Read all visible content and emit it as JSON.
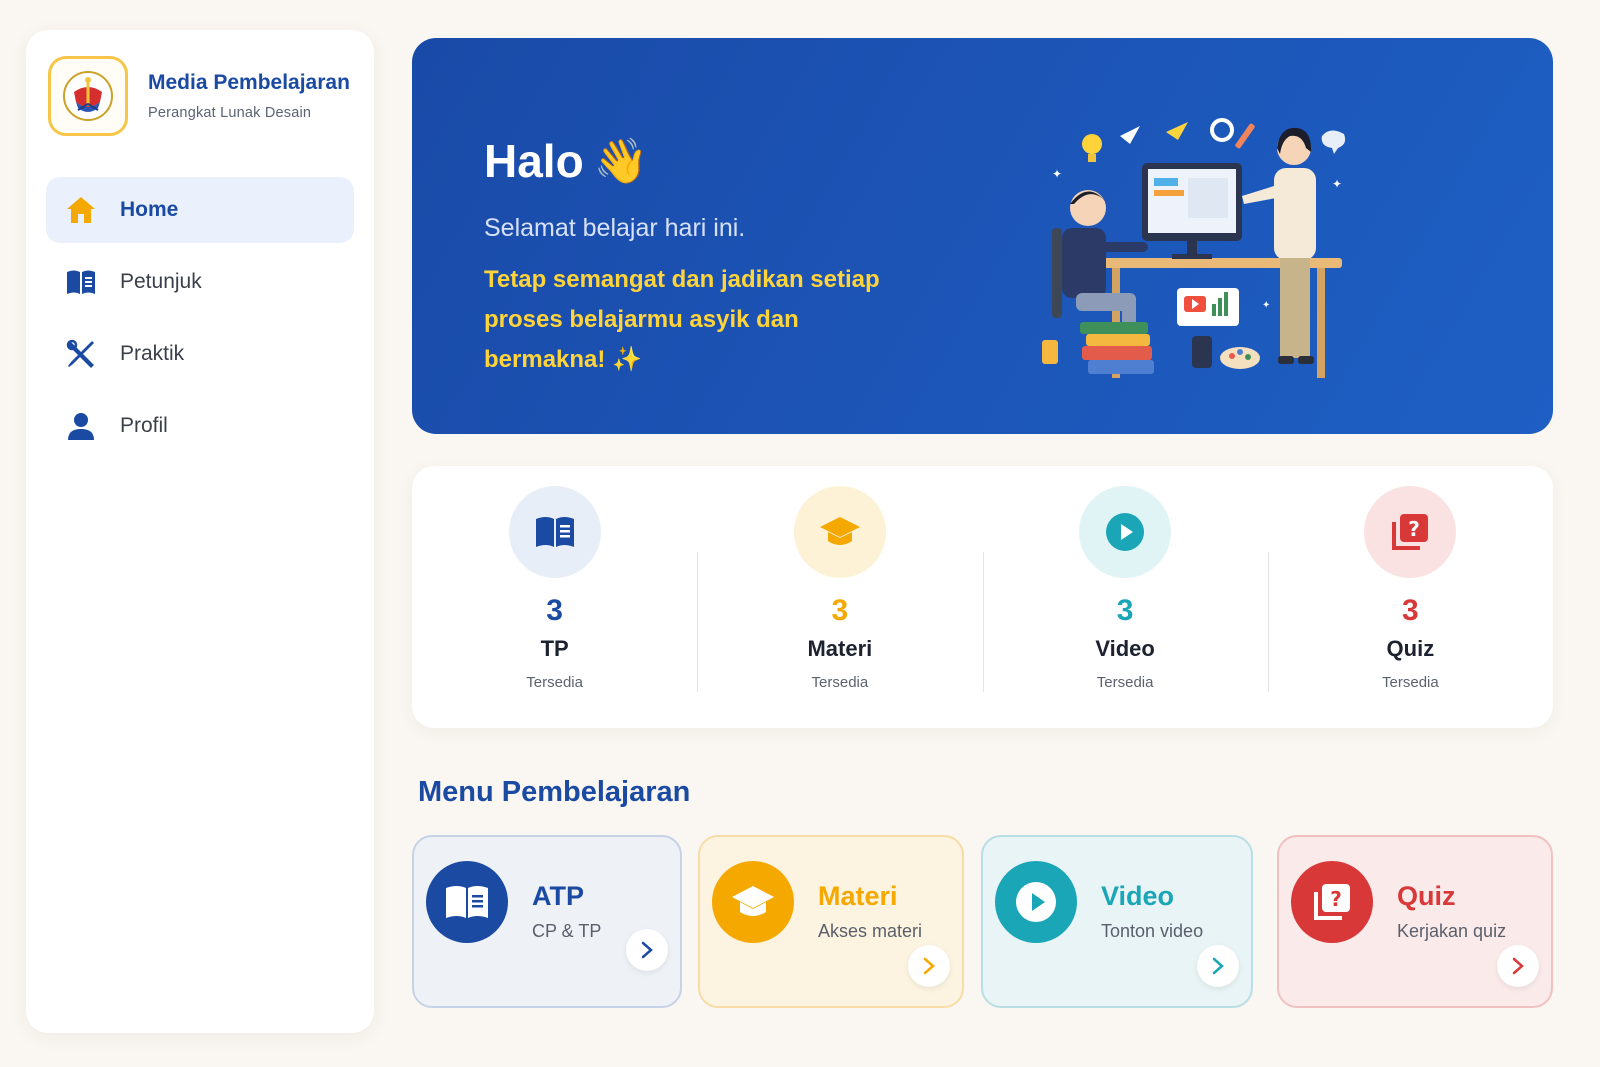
{
  "brand": {
    "title": "Media Pembelajaran",
    "subtitle": "Perangkat Lunak Desain",
    "logo": "school-emblem-icon"
  },
  "nav": {
    "items": [
      {
        "label": "Home",
        "icon": "home-icon",
        "active": true
      },
      {
        "label": "Petunjuk",
        "icon": "book-icon",
        "active": false
      },
      {
        "label": "Praktik",
        "icon": "tools-icon",
        "active": false
      },
      {
        "label": "Profil",
        "icon": "user-icon",
        "active": false
      }
    ]
  },
  "hero": {
    "greeting": "Halo",
    "greeting_emoji": "👋",
    "subtitle": "Selamat belajar hari ini.",
    "message": "Tetap semangat dan jadikan setiap proses belajarmu asyik dan bermakna! ✨",
    "illustration": "students-at-computer-illustration"
  },
  "stats": [
    {
      "count": "3",
      "name": "TP",
      "desc": "Tersedia",
      "icon": "book-icon",
      "color": "#1b4aa3",
      "bg": "#e8eef8"
    },
    {
      "count": "3",
      "name": "Materi",
      "desc": "Tersedia",
      "icon": "graduation-cap-icon",
      "color": "#f5a900",
      "bg": "#fdf1d6"
    },
    {
      "count": "3",
      "name": "Video",
      "desc": "Tersedia",
      "icon": "play-icon",
      "color": "#1aa6b7",
      "bg": "#e0f3f5"
    },
    {
      "count": "3",
      "name": "Quiz",
      "desc": "Tersedia",
      "icon": "quiz-icon",
      "color": "#d93838",
      "bg": "#fbe2e2"
    }
  ],
  "menu": {
    "title": "Menu Pembelajaran",
    "cards": [
      {
        "title": "ATP",
        "subtitle": "CP & TP",
        "icon": "book-icon",
        "color": "#1b4aa3"
      },
      {
        "title": "Materi",
        "subtitle": "Akses materi",
        "icon": "graduation-cap-icon",
        "color": "#f5a900"
      },
      {
        "title": "Video",
        "subtitle": "Tonton video",
        "icon": "play-icon",
        "color": "#1aa6b7"
      },
      {
        "title": "Quiz",
        "subtitle": "Kerjakan quiz",
        "icon": "quiz-icon",
        "color": "#d93838"
      }
    ]
  },
  "colors": {
    "primary": "#1b4aa3",
    "accent_yellow": "#ffd43b",
    "background": "#faf6f1"
  }
}
